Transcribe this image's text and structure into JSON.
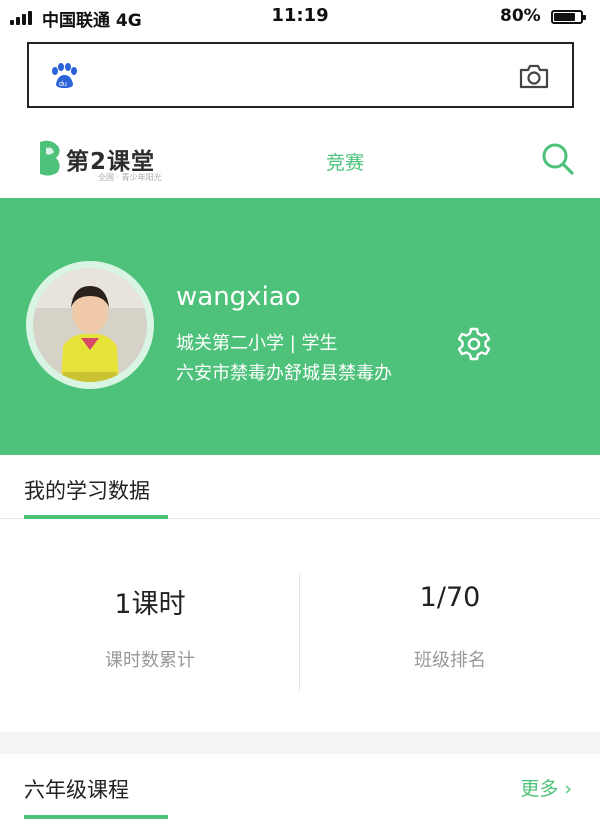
{
  "status_bar": {
    "carrier": "中国联通  4G",
    "time": "11:19",
    "battery_percent": "80%"
  },
  "search": {
    "left_icon": "baidu-paw-icon",
    "right_icon": "camera-icon"
  },
  "header": {
    "logo_text": "第2课堂",
    "logo_sub": "全国 · 青少年阳光",
    "nav_contest": "竞赛",
    "search_icon": "search-icon"
  },
  "profile": {
    "username": "wangxiao",
    "school_role": "城关第二小学 | 学生",
    "organization": "六安市禁毒办舒城县禁毒办",
    "settings_icon": "gear-icon"
  },
  "learning_data": {
    "title": "我的学习数据",
    "stats": [
      {
        "value": "1课时",
        "label": "课时数累计"
      },
      {
        "value": "1/70",
        "label": "班级排名"
      }
    ]
  },
  "courses": {
    "title": "六年级课程",
    "more_label": "更多 ›"
  },
  "colors": {
    "accent": "#4ec27a",
    "banner": "#4ec27a"
  }
}
